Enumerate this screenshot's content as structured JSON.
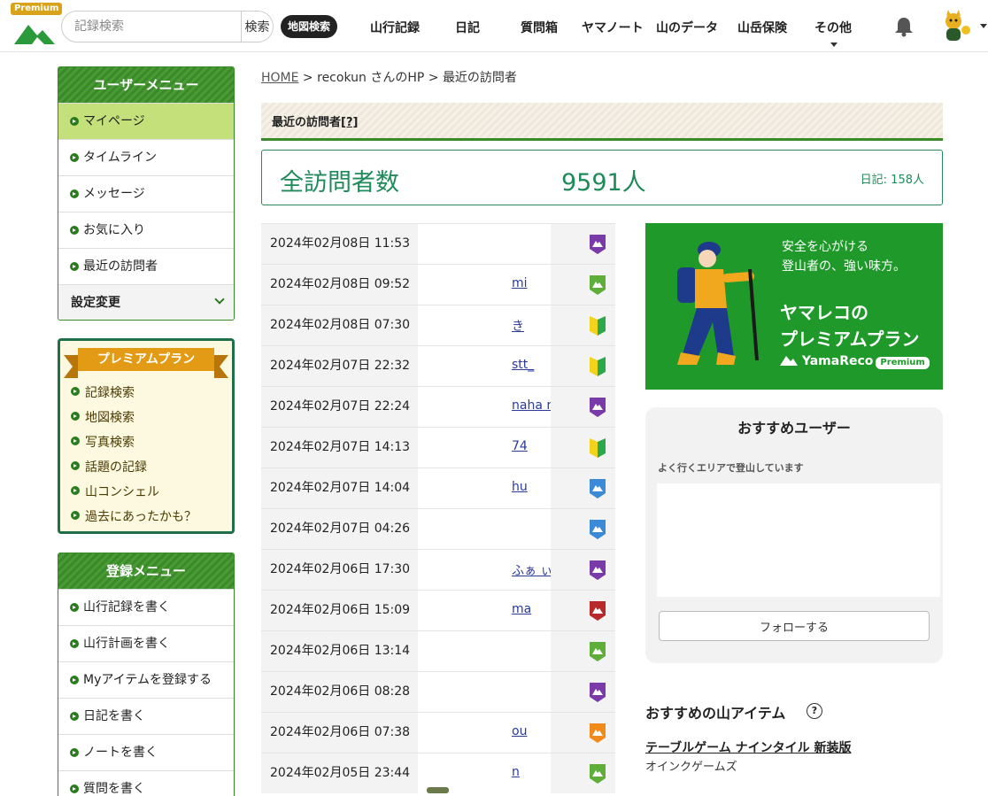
{
  "header": {
    "premium_tag": "Premium",
    "search_placeholder": "記録検索",
    "search_button": "検索",
    "map_search": "地図検索",
    "nav": [
      "山行記録",
      "日記",
      "質問箱",
      "ヤマノート",
      "山のデータ",
      "山岳保険",
      "その他"
    ],
    "icons": [
      "mountain-logo-icon",
      "bell-icon",
      "avatar-icon"
    ]
  },
  "user_menu": {
    "title": "ユーザーメニュー",
    "items": [
      "マイページ",
      "タイムライン",
      "メッセージ",
      "お気に入り",
      "最近の訪問者"
    ],
    "settings": "設定変更"
  },
  "premium_menu": {
    "title": "プレミアムプラン",
    "items": [
      "記録検索",
      "地図検索",
      "写真検索",
      "話題の記録",
      "山コンシェル",
      "過去にあったかも？"
    ]
  },
  "register_menu": {
    "title": "登録メニュー",
    "items": [
      "山行記録を書く",
      "山行計画を書く",
      "Myアイテムを登録する",
      "日記を書く",
      "ノートを書く",
      "質問を書く"
    ]
  },
  "breadcrumb": {
    "home": "HOME",
    "sep": " > ",
    "user_hp": "recokun さんのHP",
    "current": "最近の訪問者"
  },
  "section": {
    "title": "最近の訪問者",
    "help": "[?]"
  },
  "total": {
    "label": "全訪問者数",
    "value": "9591人",
    "diary": "日記: 158人"
  },
  "visitors": [
    {
      "date": "2024年02月08日 11:53",
      "user": "",
      "badge_color": "#7a3aa8"
    },
    {
      "date": "2024年02月08日 09:52",
      "user": "mi",
      "badge_color": "#5fae3a"
    },
    {
      "date": "2024年02月08日 07:30",
      "user": "き",
      "badge_color": "beginner"
    },
    {
      "date": "2024年02月07日 22:32",
      "user": "stt_",
      "badge_color": "beginner"
    },
    {
      "date": "2024年02月07日 22:24",
      "user": "naha  ru",
      "badge_color": "#7a3aa8"
    },
    {
      "date": "2024年02月07日 14:13",
      "user": "74",
      "badge_color": "beginner"
    },
    {
      "date": "2024年02月07日 14:04",
      "user": "hu",
      "badge_color": "#3a8ad8"
    },
    {
      "date": "2024年02月07日 04:26",
      "user": "",
      "badge_color": "#3a8ad8"
    },
    {
      "date": "2024年02月06日 17:30",
      "user": "ふぁ  ぃ",
      "badge_color": "#7a3aa8"
    },
    {
      "date": "2024年02月06日 15:09",
      "user": "ma",
      "badge_color": "#b82a2a"
    },
    {
      "date": "2024年02月06日 13:14",
      "user": "",
      "badge_color": "#5fae3a"
    },
    {
      "date": "2024年02月06日 08:28",
      "user": "",
      "badge_color": "#7a3aa8"
    },
    {
      "date": "2024年02月06日 07:38",
      "user": "ou",
      "badge_color": "#f08a1a"
    },
    {
      "date": "2024年02月05日 23:44",
      "user": "n",
      "badge_color": "#5fae3a"
    }
  ],
  "ad": {
    "tagline1": "安全を心がける",
    "tagline2": "登山者の、強い味方。",
    "title1": "ヤマレコの",
    "title2": "プレミアムプラン",
    "logo": "YamaReco",
    "logo_premium": "Premium",
    "bg_color": "#1f9a2a"
  },
  "recommend": {
    "title": "おすすめユーザー",
    "subtitle": "よく行くエリアで登山しています",
    "follow": "フォローする"
  },
  "items": {
    "title": "おすすめの山アイテム",
    "help": "?",
    "name": "テーブルゲーム ナインタイル 新装版",
    "maker": "オインクゲームズ"
  }
}
